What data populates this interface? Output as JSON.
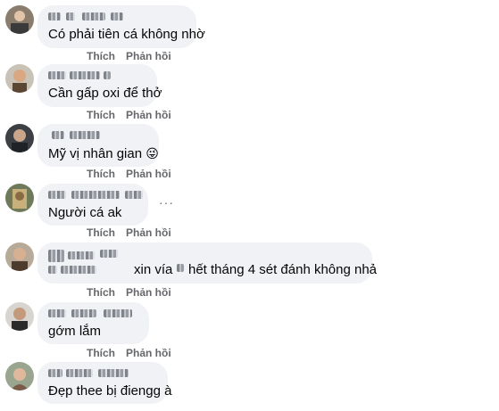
{
  "actions": {
    "like": "Thích",
    "reply": "Phản hồi"
  },
  "more_icon": "more-horizontal-icon",
  "comments": [
    {
      "text": "Có phải tiên cá không nhờ"
    },
    {
      "text": "Cần gấp oxi để thở"
    },
    {
      "text": "Mỹ vị nhân gian",
      "emoji": "😜"
    },
    {
      "text": "Người cá ak"
    },
    {
      "text_before": "xin vía",
      "text_after": "hết tháng 4 sét đánh không nhả"
    },
    {
      "text": "gớm lắm"
    },
    {
      "text": "Đẹp thee bị điengg à"
    }
  ]
}
